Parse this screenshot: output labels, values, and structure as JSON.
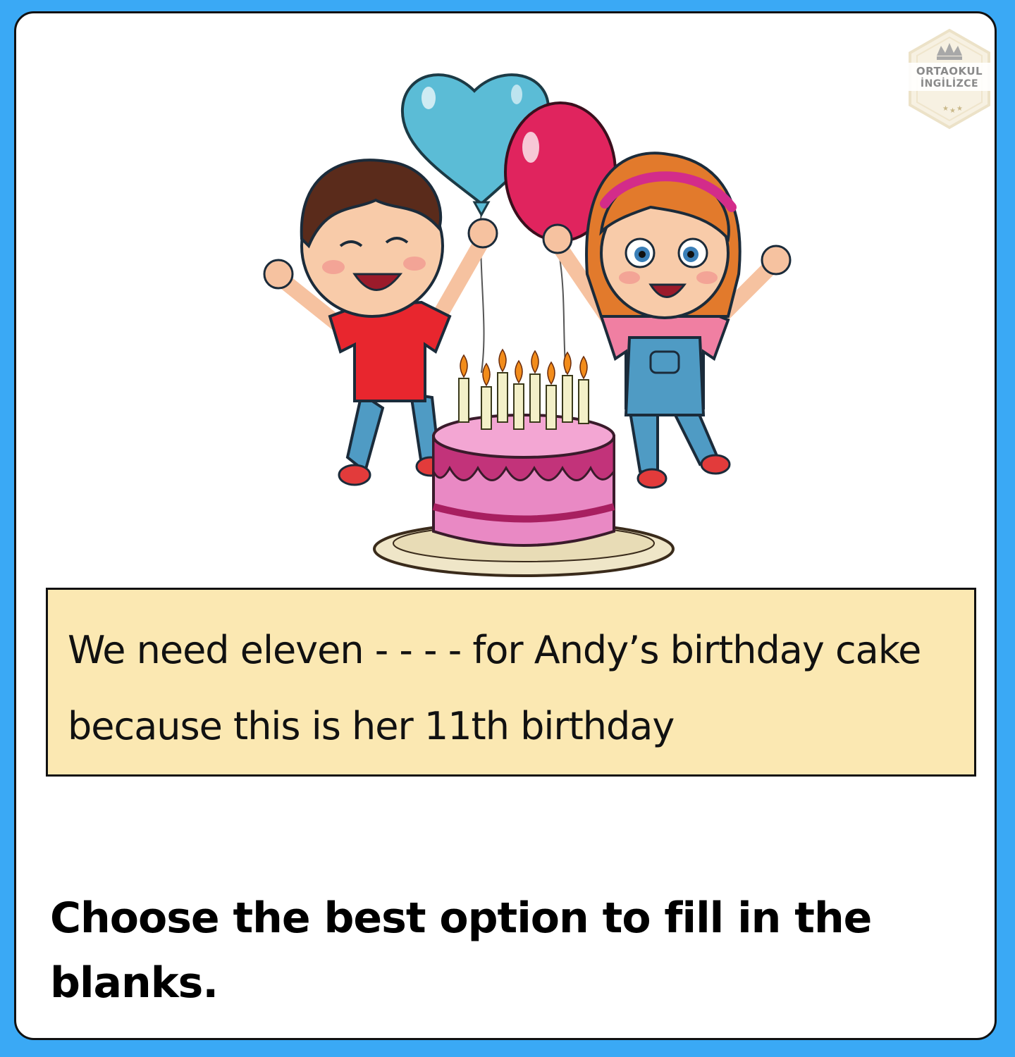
{
  "logo": {
    "line1": "ORTAOKUL",
    "line2": "İNGİLİZCE",
    "icon": "crown-icon"
  },
  "illustration": {
    "icons": [
      "heart-balloon-icon",
      "red-balloon-icon",
      "boy-icon",
      "girl-icon",
      "birthday-cake-icon"
    ]
  },
  "question": {
    "sentence": "We need eleven - - - - for Andy’s birthday cake because this is her 11th birthday",
    "instruction": "Choose the best option to fill in the blanks."
  },
  "colors": {
    "background": "#3aa9f5",
    "card": "#ffffff",
    "sentence_box": "#fbe8b2",
    "balloon_blue": "#5bbcd6",
    "balloon_red": "#e0245e",
    "cake_pink": "#e989c4"
  }
}
